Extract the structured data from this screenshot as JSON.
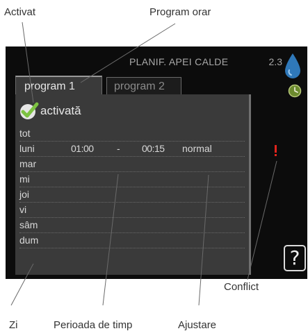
{
  "callouts": {
    "activat": "Activat",
    "program_orar": "Program orar",
    "conflict": "Conflict",
    "zi": "Zi",
    "perioada": "Perioada de timp",
    "ajustare": "Ajustare"
  },
  "screen": {
    "title": "PLANIF. APEI CALDE",
    "menu_number": "2.3",
    "tabs": [
      {
        "label": "program 1",
        "active": true
      },
      {
        "label": "program 2",
        "active": false
      }
    ],
    "activated_label": "activată",
    "rows": [
      {
        "day": "tot",
        "start": "",
        "dash": "",
        "end": "",
        "adjust": ""
      },
      {
        "day": "luni",
        "start": "01:00",
        "dash": "-",
        "end": "00:15",
        "adjust": "normal"
      },
      {
        "day": "mar",
        "start": "",
        "dash": "",
        "end": "",
        "adjust": ""
      },
      {
        "day": "mi",
        "start": "",
        "dash": "",
        "end": "",
        "adjust": ""
      },
      {
        "day": "joi",
        "start": "",
        "dash": "",
        "end": "",
        "adjust": ""
      },
      {
        "day": "vi",
        "start": "",
        "dash": "",
        "end": "",
        "adjust": ""
      },
      {
        "day": "sâm",
        "start": "",
        "dash": "",
        "end": "",
        "adjust": ""
      },
      {
        "day": "dum",
        "start": "",
        "dash": "",
        "end": "",
        "adjust": ""
      }
    ],
    "help_label": "?",
    "icons": {
      "side_top": "water-drop-icon",
      "side_mid": "clock-icon",
      "check": "check-icon",
      "conflict": "conflict-exclamation-icon"
    },
    "colors": {
      "background": "#0c0c0c",
      "panel": "#3a3a3a",
      "check_green": "#7dc242",
      "conflict_red": "#e0241d",
      "drop_blue": "#2f78b9"
    }
  }
}
